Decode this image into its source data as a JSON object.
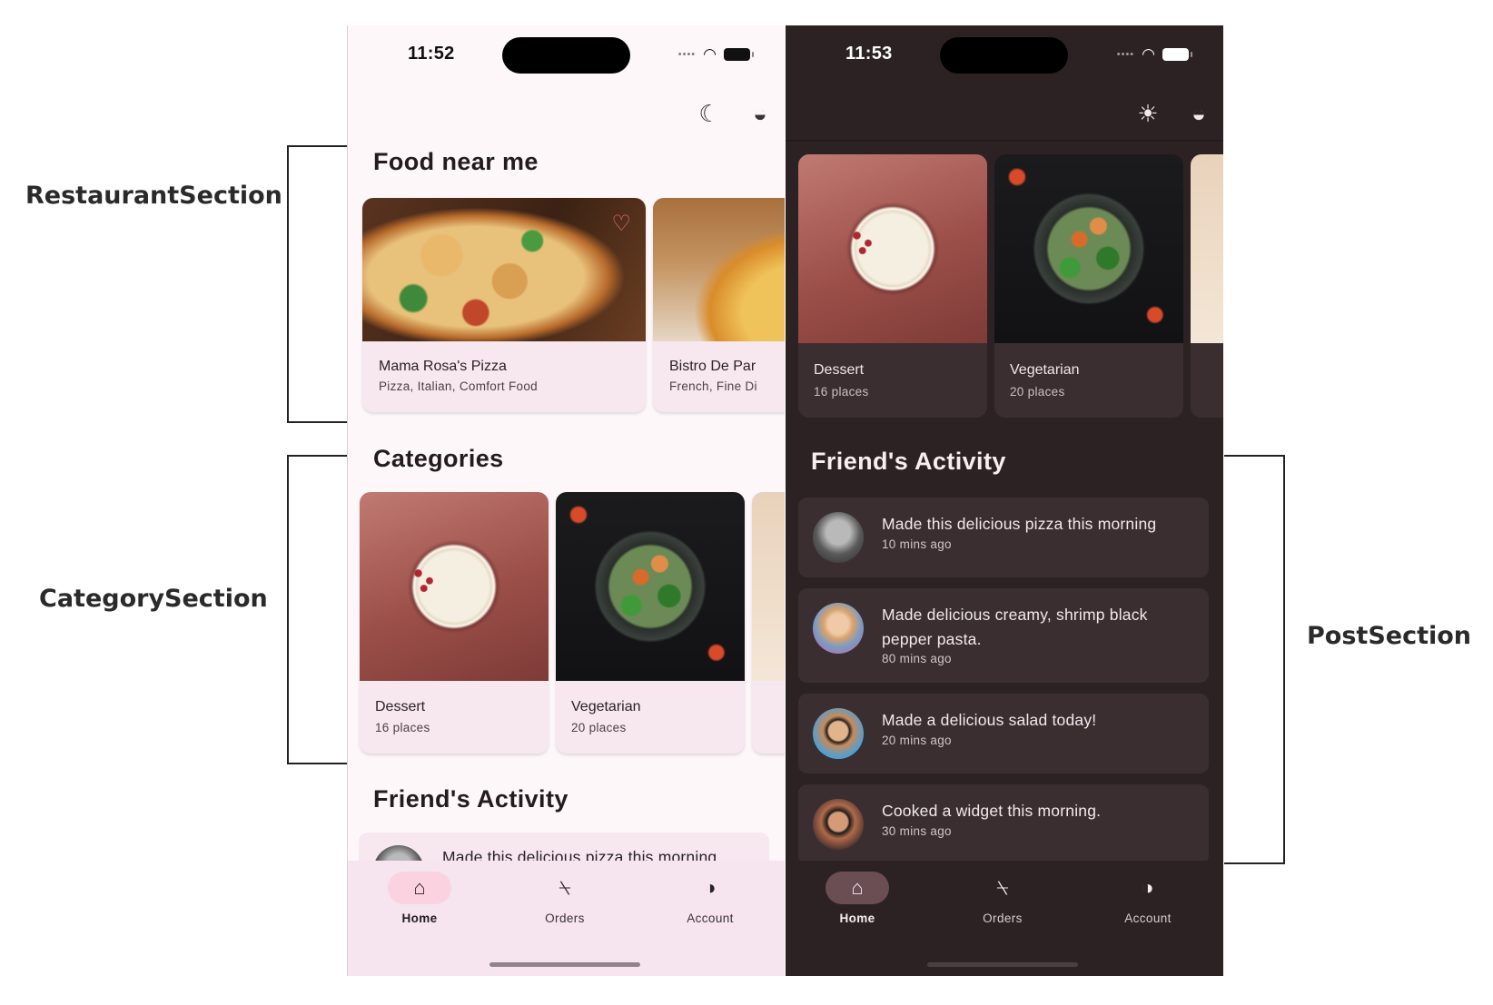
{
  "annotations": {
    "restaurant_section": "RestaurantSection",
    "category_section": "CategorySection",
    "post_section": "PostSection"
  },
  "light": {
    "status_time": "11:52",
    "food_title": "Food near me",
    "restaurants": [
      {
        "name": "Mama Rosa's Pizza",
        "tags": "Pizza, Italian, Comfort Food"
      },
      {
        "name": "Bistro De Par",
        "tags": "French, Fine Di"
      }
    ],
    "categories_title": "Categories",
    "categories": [
      {
        "name": "Dessert",
        "count": "16 places"
      },
      {
        "name": "Vegetarian",
        "count": "20 places"
      }
    ],
    "activity_title": "Friend's Activity",
    "activity_peek": "Made this delicious pizza this morning",
    "nav": {
      "home": "Home",
      "orders": "Orders",
      "account": "Account"
    }
  },
  "dark": {
    "status_time": "11:53",
    "categories": [
      {
        "name": "Dessert",
        "count": "16 places"
      },
      {
        "name": "Vegetarian",
        "count": "20 places"
      }
    ],
    "activity_title": "Friend's Activity",
    "posts": [
      {
        "message": "Made this delicious pizza this morning",
        "time": "10 mins ago"
      },
      {
        "message": "Made delicious creamy, shrimp black pepper pasta.",
        "time": "80 mins ago"
      },
      {
        "message": "Made a delicious salad today!",
        "time": "20 mins ago"
      },
      {
        "message": "Cooked a widget this morning.",
        "time": "30 mins ago"
      }
    ],
    "nav": {
      "home": "Home",
      "orders": "Orders",
      "account": "Account"
    }
  },
  "icons": {
    "moon": "moon-icon",
    "sun": "sun-icon",
    "drop": "color-drop-icon",
    "home": "home-icon",
    "orders": "paint-roller-icon",
    "account": "contrast-icon"
  }
}
